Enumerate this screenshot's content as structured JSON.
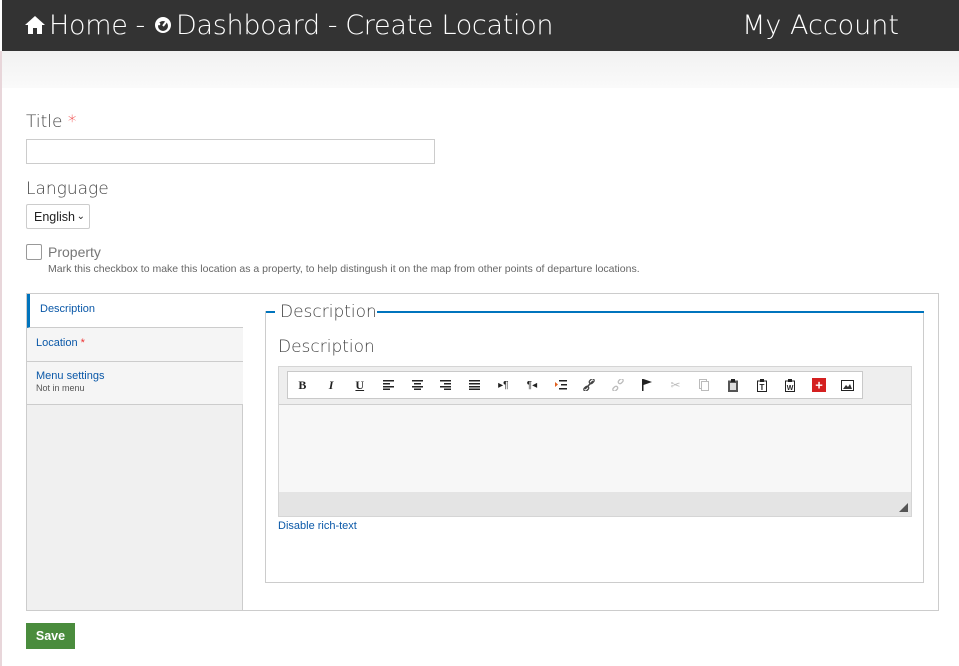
{
  "header": {
    "home_label": "Home",
    "separator": "-",
    "dashboard_label": "Dashboard",
    "page_label": "Create Location",
    "account_label": "My Account"
  },
  "form": {
    "title_label": "Title",
    "required_mark": "*",
    "title_value": "",
    "language_label": "Language",
    "language_selected": "English",
    "property_label": "Property",
    "property_checked": false,
    "property_help": "Mark this checkbox to make this location as a property, to help distingush it on the map from other points of departure locations."
  },
  "tabs": [
    {
      "label": "Description",
      "summary": ""
    },
    {
      "label": "Location",
      "required": "*",
      "summary": ""
    },
    {
      "label": "Menu settings",
      "summary": "Not in menu"
    }
  ],
  "description_panel": {
    "legend": "Description",
    "editor_label": "Description",
    "disable_link": "Disable rich-text",
    "toolbar": [
      {
        "icon": "bold-icon",
        "glyph": "B"
      },
      {
        "icon": "italic-icon",
        "glyph": "I"
      },
      {
        "icon": "underline-icon",
        "glyph": "U"
      },
      {
        "icon": "align-left-icon",
        "glyph": ""
      },
      {
        "icon": "align-center-icon",
        "glyph": ""
      },
      {
        "icon": "align-right-icon",
        "glyph": ""
      },
      {
        "icon": "align-justify-icon",
        "glyph": ""
      },
      {
        "icon": "ltr-icon",
        "glyph": "▸¶"
      },
      {
        "icon": "rtl-icon",
        "glyph": "¶◂"
      },
      {
        "icon": "indent-icon",
        "glyph": ""
      },
      {
        "icon": "link-icon",
        "glyph": ""
      },
      {
        "icon": "unlink-icon",
        "glyph": ""
      },
      {
        "icon": "anchor-flag-icon",
        "glyph": ""
      },
      {
        "icon": "cut-icon",
        "glyph": "✂"
      },
      {
        "icon": "copy-icon",
        "glyph": ""
      },
      {
        "icon": "paste-icon",
        "glyph": ""
      },
      {
        "icon": "paste-text-icon",
        "glyph": "T"
      },
      {
        "icon": "paste-word-icon",
        "glyph": "W"
      },
      {
        "icon": "plus-icon",
        "glyph": "+"
      },
      {
        "icon": "image-icon",
        "glyph": ""
      }
    ]
  },
  "actions": {
    "save_label": "Save"
  }
}
